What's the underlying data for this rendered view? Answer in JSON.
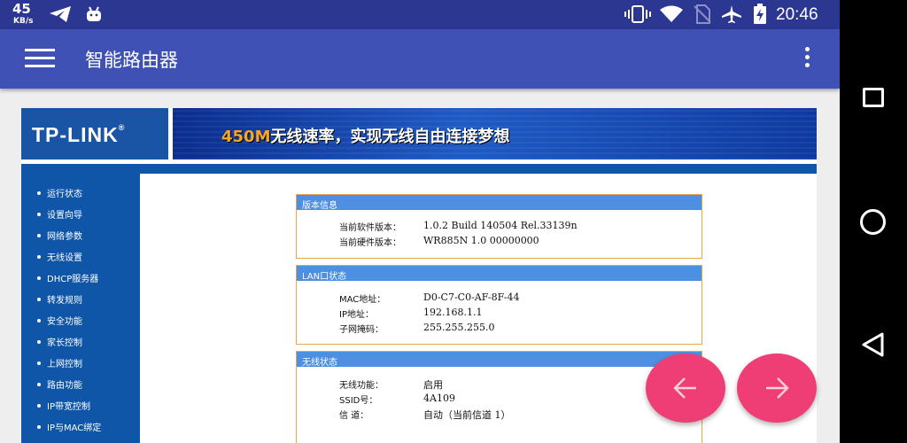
{
  "status_bar": {
    "net_speed_value": "45",
    "net_speed_unit": "KB/s",
    "time": "20:46",
    "icons": [
      "telegram-icon",
      "android-icon",
      "vibrate-icon",
      "wifi-icon",
      "no-sim-icon",
      "airplane-mode-icon",
      "battery-charging-icon"
    ]
  },
  "app_bar": {
    "title": "智能路由器",
    "menu_icon": "hamburger-menu-icon",
    "overflow_icon": "more-vert-icon"
  },
  "router_page": {
    "logo": "TP-LINK",
    "banner_speed": "450M",
    "banner_text": "无线速率，实现无线自由连接梦想",
    "sidebar": [
      "运行状态",
      "设置向导",
      "网络参数",
      "无线设置",
      "DHCP服务器",
      "转发规则",
      "安全功能",
      "家长控制",
      "上网控制",
      "路由功能",
      "IP带宽控制",
      "IP与MAC绑定"
    ],
    "panels": [
      {
        "title": "版本信息",
        "rows": [
          {
            "label": "当前软件版本：",
            "value": "1.0.2 Build 140504 Rel.33139n"
          },
          {
            "label": "当前硬件版本：",
            "value": "WR885N 1.0 00000000"
          }
        ]
      },
      {
        "title": "LAN口状态",
        "rows": [
          {
            "label": "MAC地址：",
            "value": "D0-C7-C0-AF-8F-44"
          },
          {
            "label": "IP地址：",
            "value": "192.168.1.1"
          },
          {
            "label": "子网掩码：",
            "value": "255.255.255.0"
          }
        ]
      },
      {
        "title": "无线状态",
        "rows": [
          {
            "label": "无线功能：",
            "value": "启用"
          },
          {
            "label": "SSID号：",
            "value": "4A109"
          },
          {
            "label": "信 道：",
            "value": "自动（当前信道 1）"
          }
        ]
      }
    ]
  },
  "fabs": {
    "back_icon": "arrow-left-icon",
    "forward_icon": "arrow-right-icon",
    "color": "#ef3e75"
  },
  "nav_bar": {
    "icons": [
      "recents-square-icon",
      "home-circle-icon",
      "back-triangle-icon"
    ]
  },
  "colors": {
    "status_bar": "#2c3792",
    "app_bar": "#3f51b5",
    "router_blue": "#0f55a8",
    "panel_header": "#4d8fe0",
    "panel_border": "#e8a64c"
  }
}
